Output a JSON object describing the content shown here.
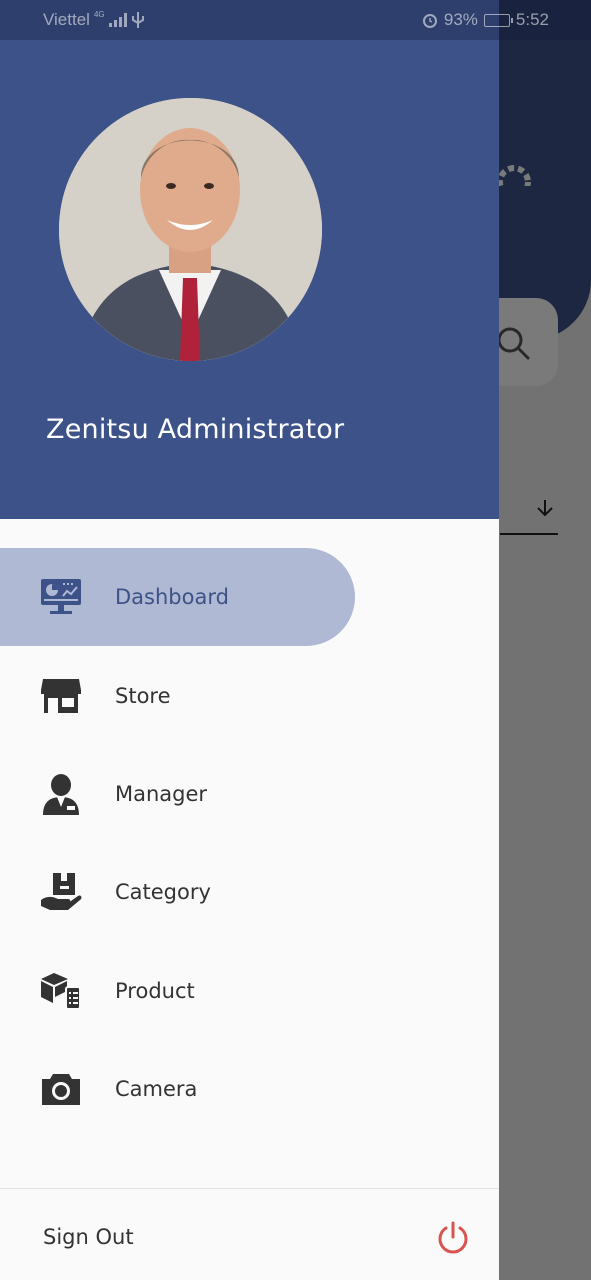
{
  "status_bar": {
    "carrier": "Viettel",
    "network": "4G",
    "battery": "93%",
    "time": "5:52"
  },
  "drawer": {
    "user_name": "Zenitsu Administrator",
    "menu": [
      {
        "label": "Dashboard",
        "icon": "dashboard-icon",
        "active": true
      },
      {
        "label": "Store",
        "icon": "store-icon",
        "active": false
      },
      {
        "label": "Manager",
        "icon": "manager-icon",
        "active": false
      },
      {
        "label": "Category",
        "icon": "category-icon",
        "active": false
      },
      {
        "label": "Product",
        "icon": "product-icon",
        "active": false
      },
      {
        "label": "Camera",
        "icon": "camera-icon",
        "active": false
      }
    ],
    "sign_out_label": "Sign Out"
  },
  "colors": {
    "primary": "#3d5288",
    "active_bg": "#b0b9d3",
    "icon": "#333333",
    "power": "#d9534f"
  }
}
